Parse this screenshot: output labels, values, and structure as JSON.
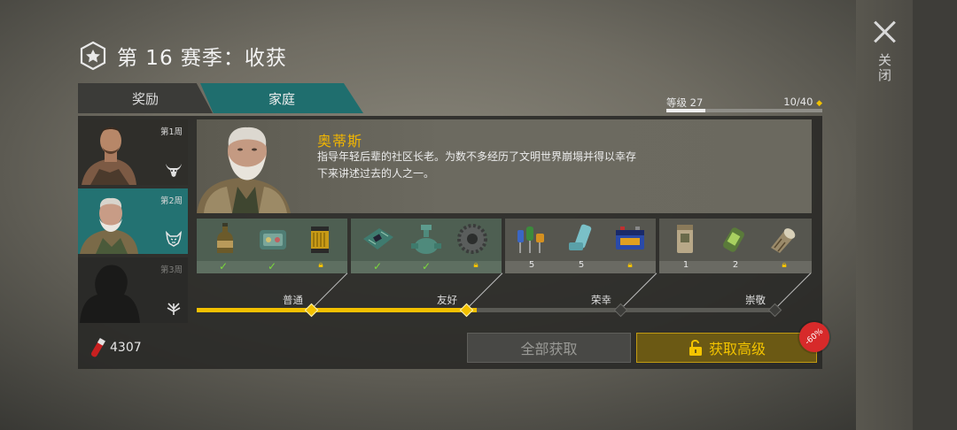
{
  "header": {
    "title": "第 16 赛季：收获",
    "close_label": "关闭"
  },
  "tabs": [
    {
      "label": "奖励",
      "active": false
    },
    {
      "label": "家庭",
      "active": true
    }
  ],
  "level": {
    "label": "等级 27",
    "count": "10/40",
    "progress": 0.25
  },
  "weeks": [
    {
      "label": "第1周",
      "state": "unlocked"
    },
    {
      "label": "第2周",
      "state": "selected"
    },
    {
      "label": "第3周",
      "state": "locked"
    }
  ],
  "character": {
    "name": "奥蒂斯",
    "description": "指导年轻后辈的社区长老。为数不多经历了文明世界崩塌并得以幸存下来讲述过去的人之一。"
  },
  "tiers": [
    {
      "name": "普通",
      "items": [
        {
          "icon": "bottle-icon",
          "status": "check"
        },
        {
          "icon": "sewing-kit-icon",
          "status": "check"
        },
        {
          "icon": "oil-filter-icon",
          "status": "lock"
        }
      ]
    },
    {
      "name": "友好",
      "items": [
        {
          "icon": "circuit-board-icon",
          "status": "check"
        },
        {
          "icon": "valve-icon",
          "status": "check"
        },
        {
          "icon": "gear-icon",
          "status": "lock"
        }
      ]
    },
    {
      "name": "荣幸",
      "items": [
        {
          "icon": "electronic-parts-icon",
          "status": "5"
        },
        {
          "icon": "inhaler-icon",
          "status": "5"
        },
        {
          "icon": "battery-icon",
          "status": "lock"
        }
      ]
    },
    {
      "name": "崇敬",
      "items": [
        {
          "icon": "ration-pack-icon",
          "status": "1"
        },
        {
          "icon": "canteen-icon",
          "status": "2"
        },
        {
          "icon": "flashlight-icon",
          "status": "lock"
        }
      ]
    }
  ],
  "affection_progress": 0.483,
  "footer": {
    "currency_value": "4307",
    "claim_all_label": "全部获取",
    "premium_label": "获取高级",
    "discount": "-60%"
  },
  "colors": {
    "accent_teal": "#1f6e6e",
    "accent_gold": "#f2c000",
    "discount_red": "#d72a2a",
    "check_green": "#7bd83c"
  }
}
